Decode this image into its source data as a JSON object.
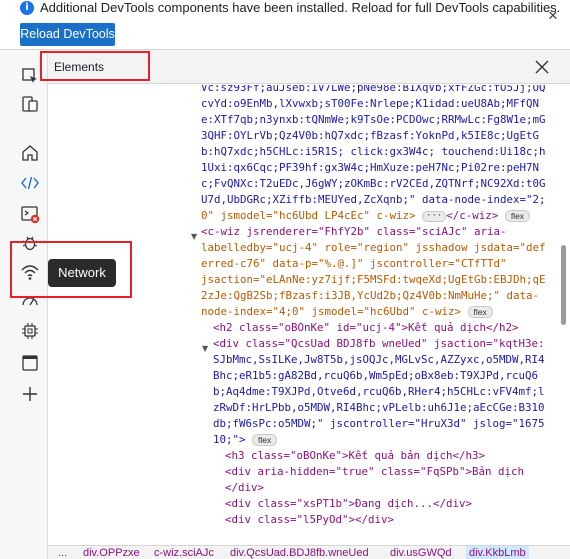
{
  "infobar": {
    "message": "Additional DevTools components have been installed. Reload for full DevTools capabilities.",
    "reload_label": "Reload DevTools",
    "info_icon": "i",
    "close_icon": "✕"
  },
  "panel": {
    "title": "Elements",
    "close_icon": "close-icon"
  },
  "activity_bar": {
    "icons": [
      "inspect-icon",
      "device-emulation-icon",
      "welcome-home-icon",
      "elements-code-icon",
      "console-error-icon",
      "sources-bug-icon",
      "network-wifi-icon",
      "performance-icon",
      "memory-chip-icon",
      "application-window-icon",
      "add-tool-icon"
    ],
    "tooltip": "Network"
  },
  "code": {
    "l1": "Vc:sz93Ff;auJseb:IV7LWe;pNe98e:B1XqVb;xfFZGc:fO5Jj;OQ",
    "l2": "cvYd:o9EnMb,lXvwxb;sT00Fe:Nrlepe;K1idad:ueU8Ab;MFfQN",
    "l3": "e:XTf7qb;n3ynxb:tQNmWe;k9TsOe:PCDOwc;RRMwLc:Fg8W1e;mG",
    "l4": "3QHF:OYLrVb;Qz4V0b:hQ7xdc;fBzasf:YoknPd,k5IE8c;UgEtG",
    "l5": "b:hQ7xdc;h5CHLc:i5R1S; click:gx3W4c; touchend:Ui18c;h",
    "l6": "1Uxi:qx6Cqc;PF39hf:gx3W4c;HmXuze:peH7Nc;Pi02re:peH7N",
    "l7": "c;FvQNXc:T2uEDc,J6gWY;zOKmBc:rV2CEd,ZQTNrf;NC92Xd:t0G",
    "l8": "U7d,UbDGRc;XZiffb:MEUYed,ZcXqnb;\" data-node-index=\"2;",
    "l9a": "0\" jsmodel=\"hc6Ubd LP4cEc\" c-wiz>",
    "l9b": "</c-wiz>",
    "l10": "<c-wiz jsrenderer=\"FhfY2b\" class=\"sciAJc\" aria-",
    "l11": "labelledby=\"ucj-4\" role=\"region\" jsshadow jsdata=\"def",
    "l12": "erred-c76\" data-p=\"%.@.]\" jscontroller=\"CTfTTd\"",
    "l13": "jsaction=\"eLAnNe:yz7ijf;F5MSFd:twqeXd;UgEtGb:EBJDh;qE",
    "l14": "2zJe:QgB2Sb;fBzasf:i3JB,YcUd2b;Qz4V0b:NmMuHe;\" data-",
    "l15": "node-index=\"4;0\" jsmodel=\"hc6Ubd\" c-wiz>",
    "l16": "<h2 class=\"oBOnKe\" id=\"ucj-4\">Kết quả dịch</h2>",
    "l17": "<div class=\"QcsUad BDJ8fb wneUed\" jsaction=\"kqtH3e:",
    "l18": "SJbMmc,SsILKe,Jw8T5b,jsOQJc,MGLvSc,AZZyxc,o5MDW,RI4",
    "l19": "Bhc;eR1b5:gA82Bd,rcuQ6b,Wm5pEd;oBx8eb:T9XJPd,rcuQ6",
    "l20": "b;Aq4dme:T9XJPd,Otve6d,rcuQ6b,RHer4;h5CHLc:vFV4mf;l",
    "l21": "zRwDf:HrLPbb,o5MDW,RI4Bhc;vPLelb:uh6J1e;aEcCGe:B310",
    "l22": "db;fW6sPc:o5MDW;\" jscontroller=\"HruX3d\" jslog=\"1675",
    "l23": "10;\">",
    "l24": "<h3 class=\"oBOnKe\">Kết quả bản dịch</h3>",
    "l25": "<div aria-hidden=\"true\" class=\"FqSPb\">Bản dịch",
    "l26": "</div>",
    "l27": "<div class=\"xsPT1b\">Đang dịch...</div>",
    "l28": "<div class=\"l5PyOd\"></div>",
    "flex": "flex",
    "ellipsis": "···"
  },
  "breadcrumbs": {
    "dots": "...",
    "items": [
      "div.OPPzxe",
      "c-wiz.sciAJc",
      "div.QcsUad.BDJ8fb.wneUed",
      "div.usGWQd",
      "div.KkbLmb"
    ]
  }
}
